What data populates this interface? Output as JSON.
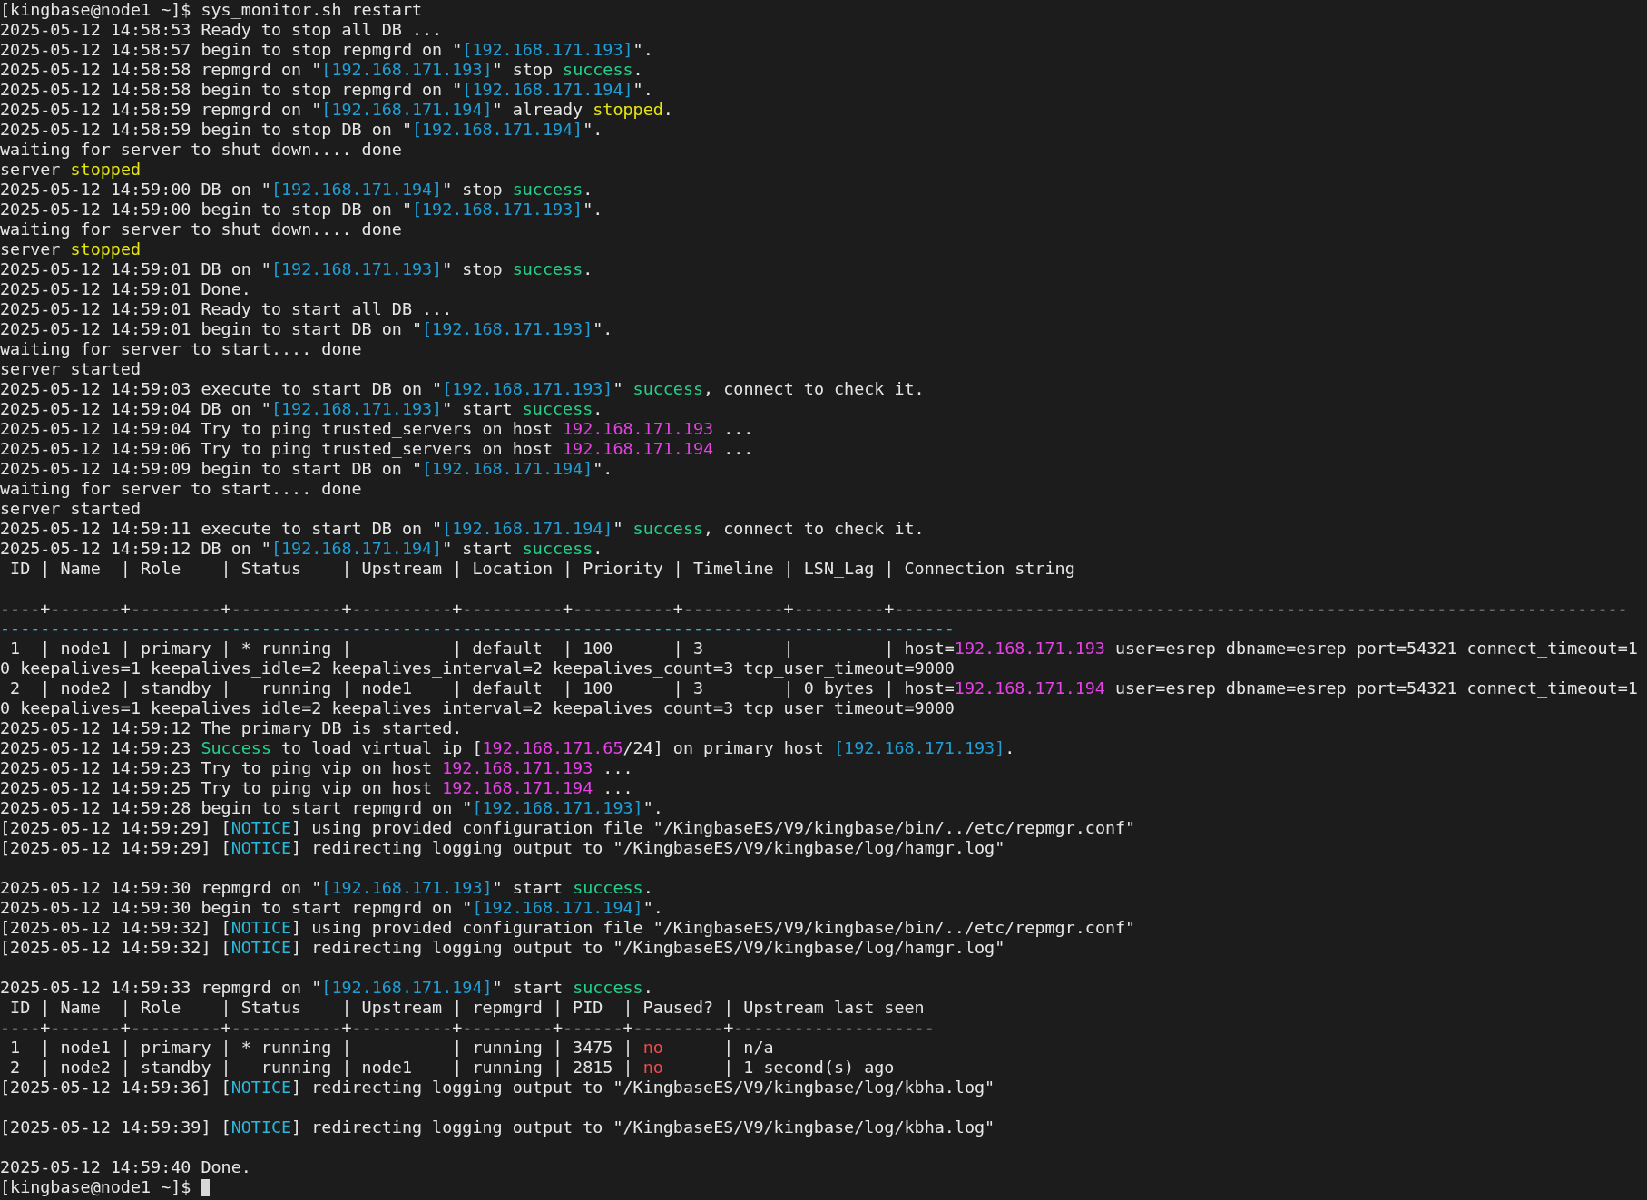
{
  "lines": [
    {
      "kind": "text",
      "segments": [
        {
          "text": "[kingbase@node1 ~]$ sys_monitor.sh restart"
        }
      ]
    },
    {
      "kind": "text",
      "segments": [
        {
          "text": "2025-05-12 14:58:53 Ready to stop all DB ..."
        }
      ]
    },
    {
      "kind": "text",
      "segments": [
        {
          "text": "2025-05-12 14:58:57 begin to stop repmgrd on \""
        },
        {
          "text": "[192.168.171.193]",
          "color": "#1f9fd6"
        },
        {
          "text": "\"."
        }
      ]
    },
    {
      "kind": "text",
      "segments": [
        {
          "text": "2025-05-12 14:58:58 repmgrd on \""
        },
        {
          "text": "[192.168.171.193]",
          "color": "#1f9fd6"
        },
        {
          "text": "\" stop "
        },
        {
          "text": "success",
          "color": "#23d18b"
        },
        {
          "text": "."
        }
      ]
    },
    {
      "kind": "text",
      "segments": [
        {
          "text": "2025-05-12 14:58:58 begin to stop repmgrd on \""
        },
        {
          "text": "[192.168.171.194]",
          "color": "#1f9fd6"
        },
        {
          "text": "\"."
        }
      ]
    },
    {
      "kind": "text",
      "segments": [
        {
          "text": "2025-05-12 14:58:59 repmgrd on \""
        },
        {
          "text": "[192.168.171.194]",
          "color": "#1f9fd6"
        },
        {
          "text": "\" already "
        },
        {
          "text": "stopped",
          "color": "#e5e510"
        },
        {
          "text": "."
        }
      ]
    },
    {
      "kind": "text",
      "segments": [
        {
          "text": "2025-05-12 14:58:59 begin to stop DB on \""
        },
        {
          "text": "[192.168.171.194]",
          "color": "#1f9fd6"
        },
        {
          "text": "\"."
        }
      ]
    },
    {
      "kind": "text",
      "segments": [
        {
          "text": "waiting for server to shut down.... done"
        }
      ]
    },
    {
      "kind": "text",
      "segments": [
        {
          "text": "server "
        },
        {
          "text": "stopped",
          "color": "#e5e510"
        }
      ]
    },
    {
      "kind": "text",
      "segments": [
        {
          "text": "2025-05-12 14:59:00 DB on \""
        },
        {
          "text": "[192.168.171.194]",
          "color": "#1f9fd6"
        },
        {
          "text": "\" stop "
        },
        {
          "text": "success",
          "color": "#23d18b"
        },
        {
          "text": "."
        }
      ]
    },
    {
      "kind": "text",
      "segments": [
        {
          "text": "2025-05-12 14:59:00 begin to stop DB on \""
        },
        {
          "text": "[192.168.171.193]",
          "color": "#1f9fd6"
        },
        {
          "text": "\"."
        }
      ]
    },
    {
      "kind": "text",
      "segments": [
        {
          "text": "waiting for server to shut down.... done"
        }
      ]
    },
    {
      "kind": "text",
      "segments": [
        {
          "text": "server "
        },
        {
          "text": "stopped",
          "color": "#e5e510"
        }
      ]
    },
    {
      "kind": "text",
      "segments": [
        {
          "text": "2025-05-12 14:59:01 DB on \""
        },
        {
          "text": "[192.168.171.193]",
          "color": "#1f9fd6"
        },
        {
          "text": "\" stop "
        },
        {
          "text": "success",
          "color": "#23d18b"
        },
        {
          "text": "."
        }
      ]
    },
    {
      "kind": "text",
      "segments": [
        {
          "text": "2025-05-12 14:59:01 Done."
        }
      ]
    },
    {
      "kind": "text",
      "segments": [
        {
          "text": "2025-05-12 14:59:01 Ready to start all DB ..."
        }
      ]
    },
    {
      "kind": "text",
      "segments": [
        {
          "text": "2025-05-12 14:59:01 begin to start DB on \""
        },
        {
          "text": "[192.168.171.193]",
          "color": "#1f9fd6"
        },
        {
          "text": "\"."
        }
      ]
    },
    {
      "kind": "text",
      "segments": [
        {
          "text": "waiting for server to start.... done"
        }
      ]
    },
    {
      "kind": "text",
      "segments": [
        {
          "text": "server started"
        }
      ]
    },
    {
      "kind": "text",
      "segments": [
        {
          "text": "2025-05-12 14:59:03 execute to start DB on \""
        },
        {
          "text": "[192.168.171.193]",
          "color": "#1f9fd6"
        },
        {
          "text": "\" "
        },
        {
          "text": "success",
          "color": "#23d18b"
        },
        {
          "text": ", connect to check it."
        }
      ]
    },
    {
      "kind": "text",
      "segments": [
        {
          "text": "2025-05-12 14:59:04 DB on \""
        },
        {
          "text": "[192.168.171.193]",
          "color": "#1f9fd6"
        },
        {
          "text": "\" start "
        },
        {
          "text": "success",
          "color": "#23d18b"
        },
        {
          "text": "."
        }
      ]
    },
    {
      "kind": "text",
      "segments": [
        {
          "text": "2025-05-12 14:59:04 Try to ping trusted_servers on host "
        },
        {
          "text": "192.168.171.193",
          "color": "#e541e5"
        },
        {
          "text": " ..."
        }
      ]
    },
    {
      "kind": "text",
      "segments": [
        {
          "text": "2025-05-12 14:59:06 Try to ping trusted_servers on host "
        },
        {
          "text": "192.168.171.194",
          "color": "#e541e5"
        },
        {
          "text": " ..."
        }
      ]
    },
    {
      "kind": "text",
      "segments": [
        {
          "text": "2025-05-12 14:59:09 begin to start DB on \""
        },
        {
          "text": "[192.168.171.194]",
          "color": "#1f9fd6"
        },
        {
          "text": "\"."
        }
      ]
    },
    {
      "kind": "text",
      "segments": [
        {
          "text": "waiting for server to start.... done"
        }
      ]
    },
    {
      "kind": "text",
      "segments": [
        {
          "text": "server started"
        }
      ]
    },
    {
      "kind": "text",
      "segments": [
        {
          "text": "2025-05-12 14:59:11 execute to start DB on \""
        },
        {
          "text": "[192.168.171.194]",
          "color": "#1f9fd6"
        },
        {
          "text": "\" "
        },
        {
          "text": "success",
          "color": "#23d18b"
        },
        {
          "text": ", connect to check it."
        }
      ]
    },
    {
      "kind": "text",
      "segments": [
        {
          "text": "2025-05-12 14:59:12 DB on \""
        },
        {
          "text": "[192.168.171.194]",
          "color": "#1f9fd6"
        },
        {
          "text": "\" start "
        },
        {
          "text": "success",
          "color": "#23d18b"
        },
        {
          "text": "."
        }
      ]
    },
    {
      "kind": "text",
      "segments": [
        {
          "text": " ID | Name  | Role    | Status    | Upstream | Location | Priority | Timeline | LSN_Lag | Connection string"
        }
      ]
    },
    {
      "kind": "blank"
    },
    {
      "kind": "text",
      "segments": [
        {
          "text": "----+-------+---------+-----------+----------+----------+----------+----------+---------+-------------------------------------------------------------------------"
        }
      ]
    },
    {
      "kind": "text",
      "segments": [
        {
          "text": "-----------------------------------------------------------------------------------------------",
          "color": "#29b8db"
        }
      ]
    },
    {
      "kind": "text",
      "segments": [
        {
          "text": " 1  | node1 | primary | * running |          | default  | 100      | 3        |         | host="
        },
        {
          "text": "192.168.171.193",
          "color": "#e541e5"
        },
        {
          "text": " user=esrep dbname=esrep port=54321 connect_timeout=1"
        }
      ]
    },
    {
      "kind": "text",
      "segments": [
        {
          "text": "0 keepalives=1 keepalives_idle=2 keepalives_interval=2 keepalives_count=3 tcp_user_timeout=9000"
        }
      ]
    },
    {
      "kind": "text",
      "segments": [
        {
          "text": " 2  | node2 | standby |   running | node1    | default  | 100      | 3        | 0 bytes | host="
        },
        {
          "text": "192.168.171.194",
          "color": "#e541e5"
        },
        {
          "text": " user=esrep dbname=esrep port=54321 connect_timeout=1"
        }
      ]
    },
    {
      "kind": "text",
      "segments": [
        {
          "text": "0 keepalives=1 keepalives_idle=2 keepalives_interval=2 keepalives_count=3 tcp_user_timeout=9000"
        }
      ]
    },
    {
      "kind": "text",
      "segments": [
        {
          "text": "2025-05-12 14:59:12 The primary DB is started."
        }
      ]
    },
    {
      "kind": "text",
      "segments": [
        {
          "text": "2025-05-12 14:59:23 "
        },
        {
          "text": "Success",
          "color": "#23d18b"
        },
        {
          "text": " to load virtual ip ["
        },
        {
          "text": "192.168.171.65",
          "color": "#e541e5"
        },
        {
          "text": "/24] on primary host "
        },
        {
          "text": "[192.168.171.193]",
          "color": "#1f9fd6"
        },
        {
          "text": "."
        }
      ]
    },
    {
      "kind": "text",
      "segments": [
        {
          "text": "2025-05-12 14:59:23 Try to ping vip on host "
        },
        {
          "text": "192.168.171.193",
          "color": "#e541e5"
        },
        {
          "text": " ..."
        }
      ]
    },
    {
      "kind": "text",
      "segments": [
        {
          "text": "2025-05-12 14:59:25 Try to ping vip on host "
        },
        {
          "text": "192.168.171.194",
          "color": "#e541e5"
        },
        {
          "text": " ..."
        }
      ]
    },
    {
      "kind": "text",
      "segments": [
        {
          "text": "2025-05-12 14:59:28 begin to start repmgrd on \""
        },
        {
          "text": "[192.168.171.193]",
          "color": "#1f9fd6"
        },
        {
          "text": "\"."
        }
      ]
    },
    {
      "kind": "text",
      "segments": [
        {
          "text": "[2025-05-12 14:59:29] ["
        },
        {
          "text": "NOTICE",
          "color": "#29b8db"
        },
        {
          "text": "] using provided configuration file \"/KingbaseES/V9/kingbase/bin/../etc/repmgr.conf\""
        }
      ]
    },
    {
      "kind": "text",
      "segments": [
        {
          "text": "[2025-05-12 14:59:29] ["
        },
        {
          "text": "NOTICE",
          "color": "#29b8db"
        },
        {
          "text": "] redirecting logging output to \"/KingbaseES/V9/kingbase/log/hamgr.log\""
        }
      ]
    },
    {
      "kind": "blank"
    },
    {
      "kind": "text",
      "segments": [
        {
          "text": "2025-05-12 14:59:30 repmgrd on \""
        },
        {
          "text": "[192.168.171.193]",
          "color": "#1f9fd6"
        },
        {
          "text": "\" start "
        },
        {
          "text": "success",
          "color": "#23d18b"
        },
        {
          "text": "."
        }
      ]
    },
    {
      "kind": "text",
      "segments": [
        {
          "text": "2025-05-12 14:59:30 begin to start repmgrd on \""
        },
        {
          "text": "[192.168.171.194]",
          "color": "#1f9fd6"
        },
        {
          "text": "\"."
        }
      ]
    },
    {
      "kind": "text",
      "segments": [
        {
          "text": "[2025-05-12 14:59:32] ["
        },
        {
          "text": "NOTICE",
          "color": "#29b8db"
        },
        {
          "text": "] using provided configuration file \"/KingbaseES/V9/kingbase/bin/../etc/repmgr.conf\""
        }
      ]
    },
    {
      "kind": "text",
      "segments": [
        {
          "text": "[2025-05-12 14:59:32] ["
        },
        {
          "text": "NOTICE",
          "color": "#29b8db"
        },
        {
          "text": "] redirecting logging output to \"/KingbaseES/V9/kingbase/log/hamgr.log\""
        }
      ]
    },
    {
      "kind": "blank"
    },
    {
      "kind": "text",
      "segments": [
        {
          "text": "2025-05-12 14:59:33 repmgrd on \""
        },
        {
          "text": "[192.168.171.194]",
          "color": "#1f9fd6"
        },
        {
          "text": "\" start "
        },
        {
          "text": "success",
          "color": "#23d18b"
        },
        {
          "text": "."
        }
      ]
    },
    {
      "kind": "text",
      "segments": [
        {
          "text": " ID | Name  | Role    | Status    | Upstream | repmgrd | PID  | Paused? | Upstream last seen"
        }
      ]
    },
    {
      "kind": "text",
      "segments": [
        {
          "text": "----+-------+---------+-----------+----------+---------+------+---------+--------------------"
        }
      ]
    },
    {
      "kind": "text",
      "segments": [
        {
          "text": " 1  | node1 | primary | * running |          | running | 3475 | "
        },
        {
          "text": "no",
          "color": "#f14c4c"
        },
        {
          "text": "      | n/a"
        }
      ]
    },
    {
      "kind": "text",
      "segments": [
        {
          "text": " 2  | node2 | standby |   running | node1    | running | 2815 | "
        },
        {
          "text": "no",
          "color": "#f14c4c"
        },
        {
          "text": "      | 1 second(s) ago"
        }
      ]
    },
    {
      "kind": "text",
      "segments": [
        {
          "text": "[2025-05-12 14:59:36] ["
        },
        {
          "text": "NOTICE",
          "color": "#29b8db"
        },
        {
          "text": "] redirecting logging output to \"/KingbaseES/V9/kingbase/log/kbha.log\""
        }
      ]
    },
    {
      "kind": "blank"
    },
    {
      "kind": "text",
      "segments": [
        {
          "text": "[2025-05-12 14:59:39] ["
        },
        {
          "text": "NOTICE",
          "color": "#29b8db"
        },
        {
          "text": "] redirecting logging output to \"/KingbaseES/V9/kingbase/log/kbha.log\""
        }
      ]
    },
    {
      "kind": "blank"
    },
    {
      "kind": "text",
      "segments": [
        {
          "text": "2025-05-12 14:59:40 Done."
        }
      ]
    },
    {
      "kind": "input",
      "segments": [
        {
          "text": "[kingbase@node1 ~]$ "
        }
      ]
    }
  ]
}
